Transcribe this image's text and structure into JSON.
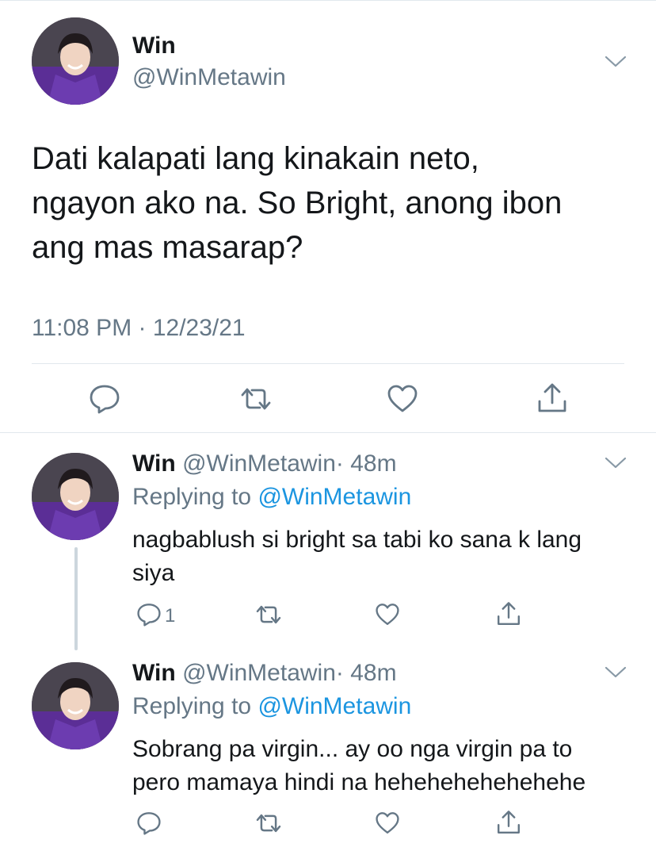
{
  "main_tweet": {
    "name": "Win",
    "handle": "@WinMetawin",
    "text_lines": [
      "Dati kalapati lang kinakain neto,",
      "ngayon ako na. So Bright, anong ibon",
      "ang mas masarap?"
    ],
    "timestamp": "11:08 PM · 12/23/21"
  },
  "replies": [
    {
      "name": "Win",
      "handle": "@WinMetawin",
      "age": "· 48m",
      "replying_label": "Replying to",
      "replying_handle": "@WinMetawin",
      "text_lines": [
        "nagbablush si bright sa tabi ko sana k lang",
        "siya"
      ],
      "reply_count": "1"
    },
    {
      "name": "Win",
      "handle": "@WinMetawin",
      "age": "· 48m",
      "replying_label": "Replying to",
      "replying_handle": "@WinMetawin",
      "text_lines": [
        "Sobrang pa virgin... ay oo nga virgin pa to",
        "pero mamaya hindi na hehehehehehehehe"
      ],
      "reply_count": ""
    }
  ],
  "icons": [
    "chevron-down-icon",
    "reply-icon",
    "retweet-icon",
    "like-icon",
    "share-icon"
  ],
  "colors": {
    "text": "#14171a",
    "secondary": "#657786",
    "link": "#1b95e0",
    "divider": "#e1e8ed",
    "avatar_purple": "#5b2e96"
  }
}
